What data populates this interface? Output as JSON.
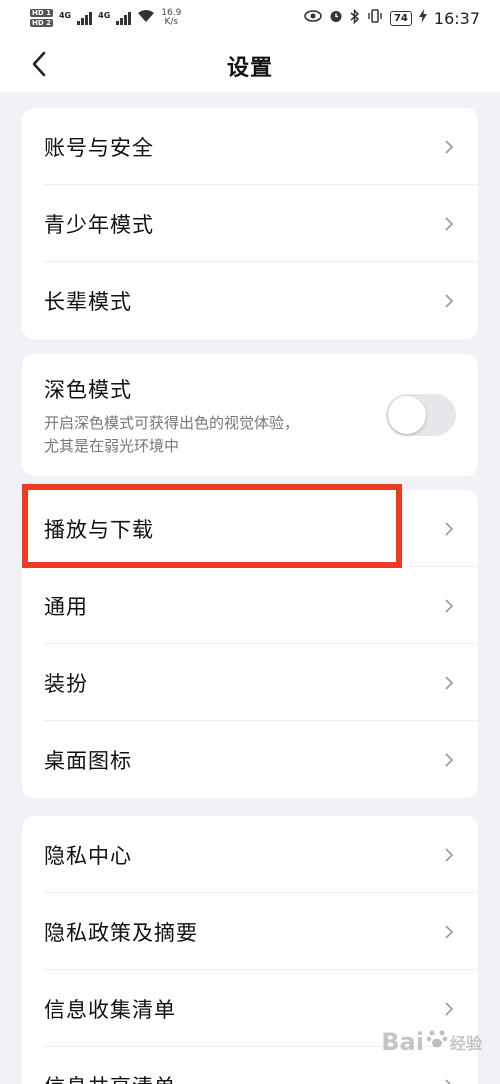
{
  "status_bar": {
    "hd1": "HD 1",
    "hd2": "HD 2",
    "net1": "4G",
    "net2": "4G",
    "speed_value": "16.9",
    "speed_unit": "K/s",
    "battery": "74",
    "time": "16:37"
  },
  "header": {
    "title": "设置"
  },
  "group1": {
    "items": [
      {
        "label": "账号与安全"
      },
      {
        "label": "青少年模式"
      },
      {
        "label": "长辈模式"
      }
    ]
  },
  "dark_mode": {
    "title": "深色模式",
    "description_line1": "开启深色模式可获得出色的视觉体验，",
    "description_line2": "尤其是在弱光环境中",
    "enabled": false
  },
  "group3": {
    "items": [
      {
        "label": "播放与下载"
      },
      {
        "label": "通用"
      },
      {
        "label": "装扮"
      },
      {
        "label": "桌面图标"
      }
    ]
  },
  "group4": {
    "items": [
      {
        "label": "隐私中心"
      },
      {
        "label": "隐私政策及摘要"
      },
      {
        "label": "信息收集清单"
      },
      {
        "label": "信息共享清单"
      }
    ]
  },
  "colors": {
    "highlight": "#ee3b22",
    "background": "#f0f2f7"
  },
  "watermark": {
    "text_left": "Bai",
    "text_right": "经验"
  }
}
